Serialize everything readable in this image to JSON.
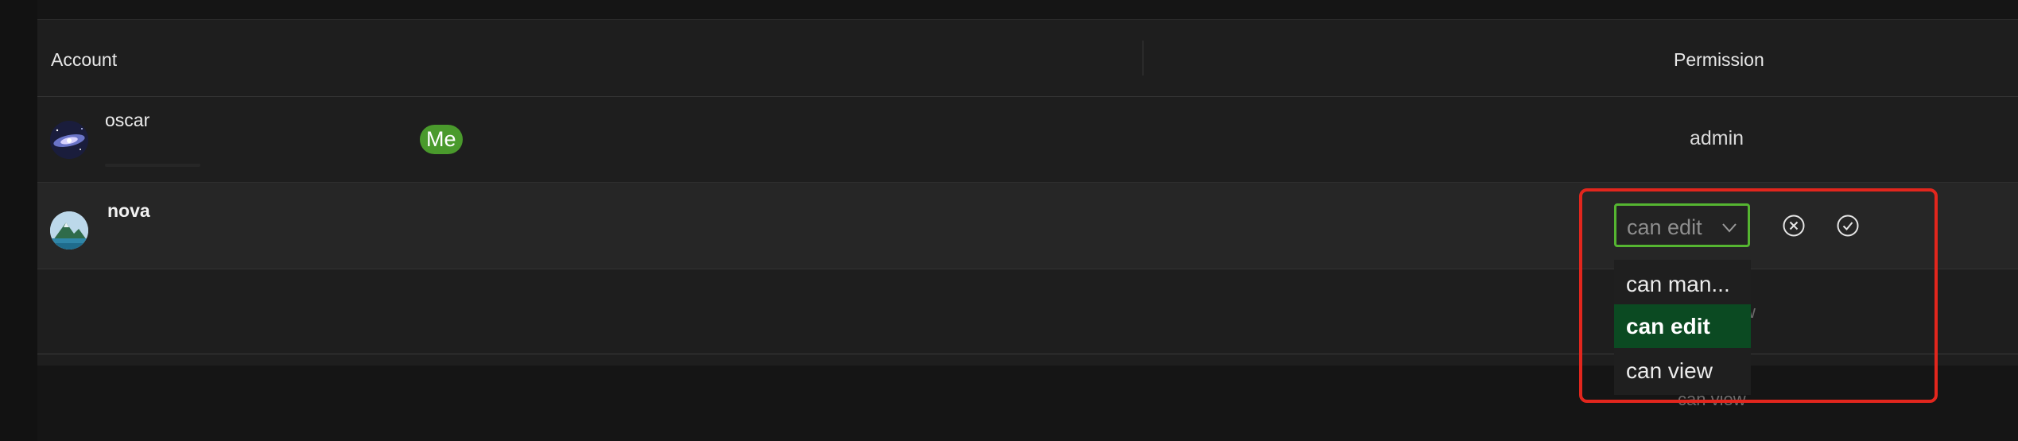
{
  "table": {
    "headers": {
      "account": "Account",
      "permission": "Permission"
    }
  },
  "rows": [
    {
      "name": "oscar",
      "badge": "Me",
      "permission": "admin"
    },
    {
      "name": "nova"
    }
  ],
  "background_text": {
    "under_dropdown_1": "w",
    "under_dropdown_2": "can view"
  },
  "editor": {
    "current_value": "can edit",
    "options": [
      "can man...",
      "can edit",
      "can view"
    ],
    "selected_option": "can edit"
  },
  "colors": {
    "accent_green": "#55b531",
    "badge_green": "#4a9a2c",
    "selected_option_bg": "#0b4a22",
    "highlight_red": "#e2261d"
  },
  "icons": {
    "cancel": "circle-x-icon",
    "confirm": "circle-check-icon",
    "chevron": "chevron-down-icon"
  }
}
